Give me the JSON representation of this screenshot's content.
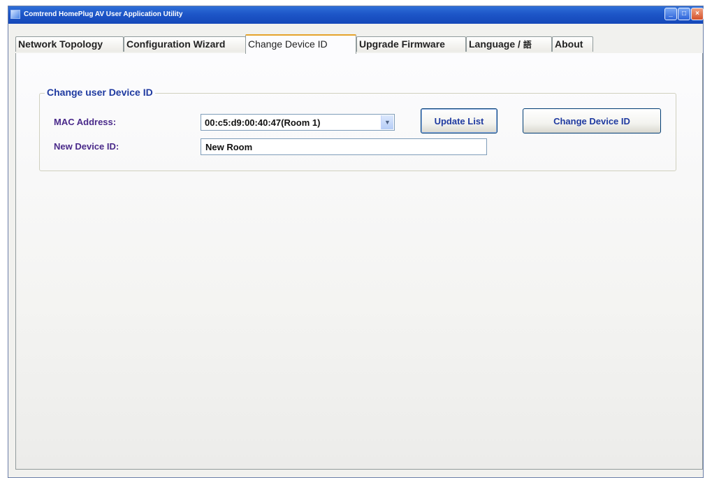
{
  "window": {
    "title": "Comtrend HomePlug AV User Application Utility",
    "controls": {
      "minimize": "_",
      "maximize": "□",
      "close": "×"
    }
  },
  "tabs": [
    {
      "label": "Network Topology"
    },
    {
      "label": "Configuration Wizard"
    },
    {
      "label": "Change Device ID"
    },
    {
      "label": "Upgrade Firmware"
    },
    {
      "label": "Language / ",
      "glyph": "語"
    },
    {
      "label": "About"
    }
  ],
  "active_tab": "Change Device ID",
  "change_device_id": {
    "group_title": "Change user Device ID",
    "mac_label": "MAC Address:",
    "mac_selected": "00:c5:d9:00:40:47(Room 1)",
    "new_id_label": "New Device ID:",
    "new_id_value": "New Room",
    "update_list_button": "Update List",
    "change_button": "Change Device ID"
  },
  "colors": {
    "titlebar": "#1d56c8",
    "label_text": "#4a2a8a",
    "button_text": "#1f3aa0",
    "active_tab_accent": "#e5a32b"
  }
}
